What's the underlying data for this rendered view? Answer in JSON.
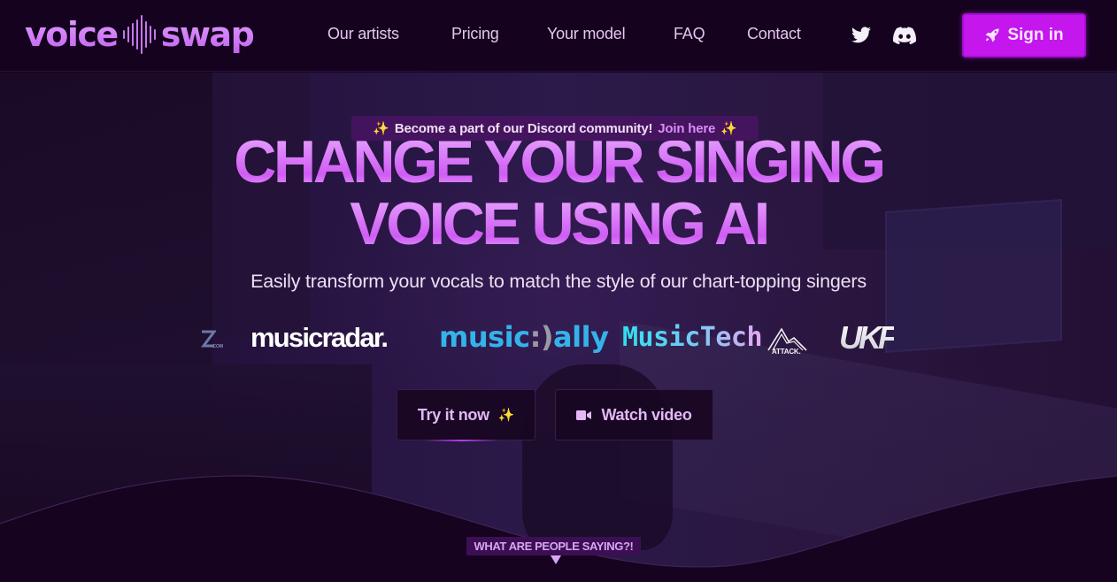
{
  "brand": {
    "name_left": "voice",
    "name_right": "swap",
    "accent_color": "#c516ee"
  },
  "nav": {
    "items": [
      {
        "label": "Our artists"
      },
      {
        "label": "Pricing"
      },
      {
        "label": "Your model"
      },
      {
        "label": "FAQ"
      },
      {
        "label": "Contact"
      }
    ],
    "social": [
      {
        "icon": "twitter-icon"
      },
      {
        "icon": "discord-icon"
      }
    ],
    "signin": {
      "label": "Sign in",
      "icon": "rocket-icon"
    }
  },
  "hero": {
    "announcement": {
      "text": "Become a part of our Discord community!",
      "link": "Join here",
      "icon": "sparkles-icon"
    },
    "headline": [
      "CHANGE YOUR SINGING",
      "VOICE USING AI"
    ],
    "subtitle": "Easily transform your vocals to match the style of our chart-topping singers",
    "press_logos": [
      {
        "name": "z.com",
        "text": ".COM"
      },
      {
        "name": "musicradar",
        "text": "musicradar."
      },
      {
        "name": "music ally",
        "text_left": "music",
        "text_mid": ":)",
        "text_right": "ally"
      },
      {
        "name": "MusicTech",
        "text": "MusicTech"
      },
      {
        "name": "Attack",
        "text": "ATTACK."
      },
      {
        "name": "UKF",
        "text": "UKF"
      }
    ],
    "buttons": {
      "try": {
        "label": "Try it now",
        "icon": "sparkles-icon"
      },
      "watch": {
        "label": "Watch video",
        "icon": "video-camera-icon"
      }
    }
  },
  "testimonials_teaser": {
    "label": "WHAT ARE PEOPLE SAYING?!",
    "icon": "triangle-down-icon"
  }
}
